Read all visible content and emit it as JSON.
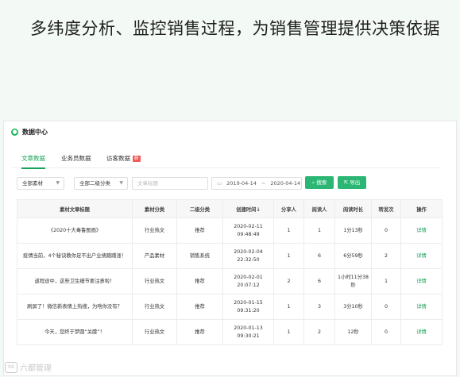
{
  "headline": "多纬度分析、监控销售过程，为销售管理提供决策依据",
  "panel": {
    "title": "数据中心"
  },
  "tabs": [
    {
      "label": "文章数据",
      "active": true
    },
    {
      "label": "业务员数据",
      "active": false
    },
    {
      "label": "访客数据",
      "active": false,
      "badge": "新"
    }
  ],
  "filters": {
    "material": "全部素材",
    "category2": "全部二级分类",
    "title_placeholder": "文章标题",
    "date_start": "2019-04-14",
    "date_sep": "~",
    "date_end": "2020-04-14",
    "search_label": "搜索",
    "export_label": "导出"
  },
  "table": {
    "headers": [
      "素材文章标题",
      "素材分类",
      "二级分类",
      "创建时间",
      "分享人",
      "阅读人",
      "阅读时长",
      "转发次",
      "操作"
    ],
    "sort_indicator": "↓",
    "rows": [
      {
        "title": "《2020十大毒鲁图画》",
        "category": "行业热文",
        "sub": "推荐",
        "time": "2020-02-11 09:48:49",
        "sharers": "1",
        "readers": "1",
        "duration": "1分13秒",
        "forwards": "0",
        "action": "详情"
      },
      {
        "title": "疫情当前，4个秘诀教你足不出户业绩蹭蹭涨！",
        "category": "产品素材",
        "sub": "销售系统",
        "time": "2020-02-04 22:32:50",
        "sharers": "1",
        "readers": "6",
        "duration": "6分59秒",
        "forwards": "2",
        "action": "详情"
      },
      {
        "title": "返程途中，这些卫生细节要注意啦！",
        "category": "行业热文",
        "sub": "推荐",
        "time": "2020-02-01 20:07:12",
        "sharers": "2",
        "readers": "6",
        "duration": "1小时11分38秒",
        "forwards": "1",
        "action": "详情"
      },
      {
        "title": "刷屏了！微信新表情上热搜，为啥你没有？",
        "category": "行业热文",
        "sub": "推荐",
        "time": "2020-01-15 09:31:20",
        "sharers": "1",
        "readers": "3",
        "duration": "3分10秒",
        "forwards": "0",
        "action": "详情"
      },
      {
        "title": "今天，您终于梦圆“关膝”！",
        "category": "行业热文",
        "sub": "推荐",
        "time": "2020-01-13 09:30:21",
        "sharers": "1",
        "readers": "2",
        "duration": "12秒",
        "forwards": "0",
        "action": "详情"
      }
    ]
  },
  "watermark": {
    "text": "六都管理",
    "logo": "K8"
  },
  "colors": {
    "accent": "#19a35a",
    "button": "#2bb673",
    "badge": "#f05a5a",
    "background": "#f3f9f4"
  }
}
